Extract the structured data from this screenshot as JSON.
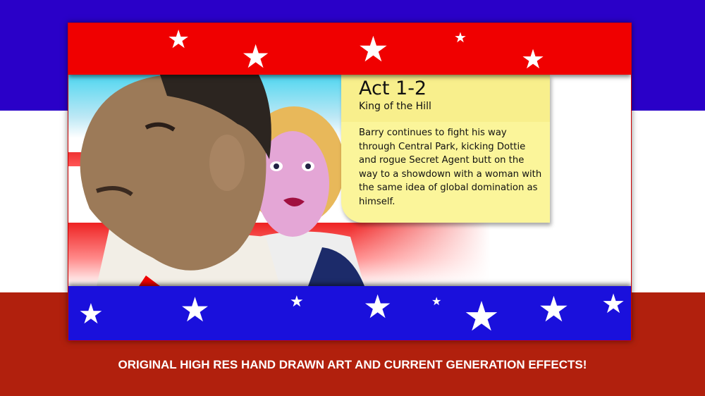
{
  "story_card": {
    "act_title": "Act 1-2",
    "act_subtitle": "King of the Hill",
    "description": "Barry continues to fight his way through Central Park, kicking Dottie and rogue Secret Agent butt on the way to a showdown with a woman with the same idea of global domination as himself."
  },
  "caption": "ORIGINAL HIGH RES HAND DRAWN ART AND CURRENT GENERATION EFFECTS!",
  "colors": {
    "top_bg": "#2a00c8",
    "bottom_bg": "#b1200d",
    "red_band": "#f00000",
    "blue_band": "#1a10dc",
    "note": "#fbf59a"
  }
}
